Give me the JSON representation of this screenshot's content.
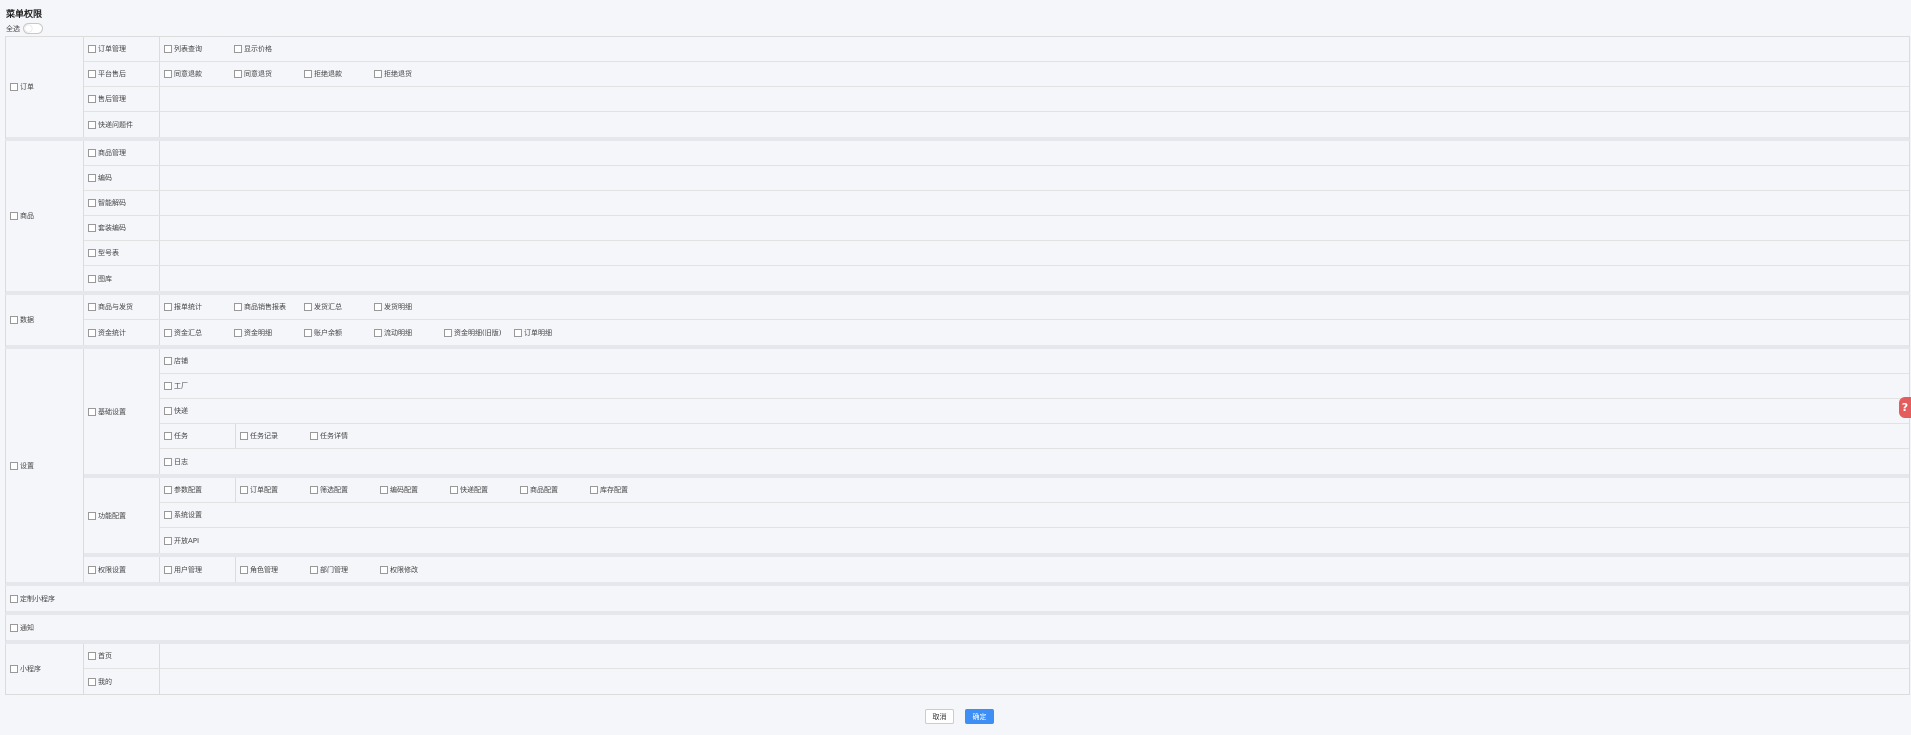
{
  "page": {
    "title": "菜单权限",
    "select_all": "全选",
    "cancel": "取消",
    "confirm": "确定",
    "help": "?"
  },
  "colors": {
    "primary": "#3d8ef5",
    "help": "#e45c5c",
    "background": "#f5f6fa"
  },
  "icons": {
    "help": "question-icon",
    "toggle": "toggle-switch"
  },
  "groups": [
    {
      "label": "订单",
      "rows": [
        {
          "label": "订单管理",
          "items": [
            "列表查询",
            "显示价格"
          ]
        },
        {
          "label": "平台售后",
          "items": [
            "同意退款",
            "同意退货",
            "拒绝退款",
            "拒绝退货"
          ]
        },
        {
          "label": "售后管理",
          "items": []
        },
        {
          "label": "快递问题件",
          "items": []
        }
      ]
    },
    {
      "label": "商品",
      "rows": [
        {
          "label": "商品管理",
          "items": []
        },
        {
          "label": "编码",
          "items": []
        },
        {
          "label": "智能解码",
          "items": []
        },
        {
          "label": "套装编码",
          "items": []
        },
        {
          "label": "型号表",
          "items": []
        },
        {
          "label": "图库",
          "items": []
        }
      ]
    },
    {
      "label": "数据",
      "rows": [
        {
          "label": "商品与发货",
          "items": [
            "报单统计",
            "商品销售报表",
            "发货汇总",
            "发货明细"
          ]
        },
        {
          "label": "资金统计",
          "items": [
            "资金汇总",
            "资金明细",
            "账户余额",
            "流动明细",
            "资金明细(旧版)",
            "订单明细"
          ]
        }
      ]
    },
    {
      "label": "设置",
      "subs": [
        {
          "label": "基础设置",
          "rows": [
            {
              "label": "店铺",
              "items": []
            },
            {
              "label": "工厂",
              "items": []
            },
            {
              "label": "快递",
              "items": []
            },
            {
              "label": "任务",
              "items": [
                "任务记录",
                "任务详情"
              ]
            },
            {
              "label": "日志",
              "items": []
            }
          ]
        },
        {
          "label": "功能配置",
          "rows": [
            {
              "label": "参数配置",
              "items": [
                "订单配置",
                "筛选配置",
                "编码配置",
                "快递配置",
                "商品配置",
                "库存配置"
              ]
            },
            {
              "label": "系统设置",
              "items": []
            },
            {
              "label": "开放API",
              "items": []
            }
          ]
        },
        {
          "label": "权限设置",
          "rows": [
            {
              "label": "用户管理",
              "items": [
                "角色管理",
                "部门管理",
                "权限修改"
              ]
            }
          ]
        }
      ]
    },
    {
      "label": "定制小程序",
      "single": true
    },
    {
      "label": "通知",
      "single": true
    },
    {
      "label": "小程序",
      "rows": [
        {
          "label": "首页",
          "items": []
        },
        {
          "label": "我的",
          "items": []
        }
      ]
    }
  ]
}
